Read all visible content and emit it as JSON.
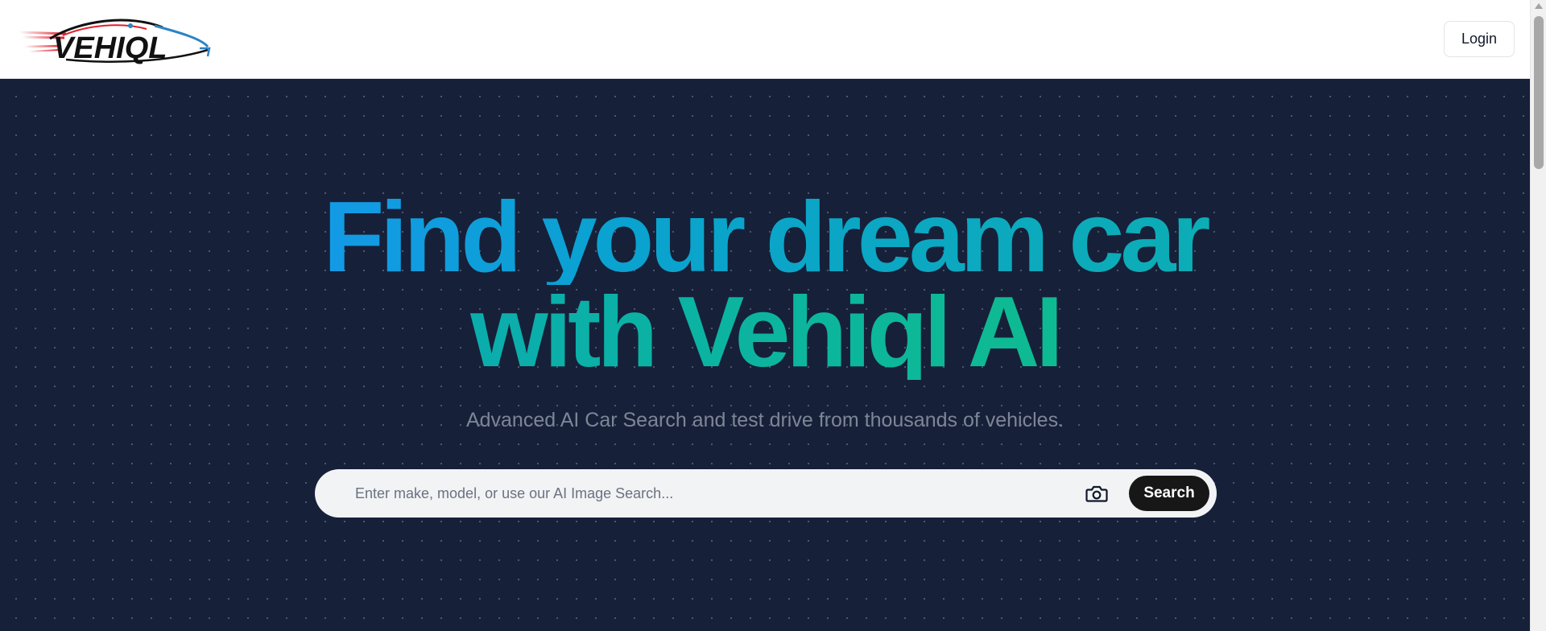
{
  "header": {
    "logo_text": "VEHIQL",
    "login_label": "Login"
  },
  "hero": {
    "headline_line1": "Find your dream car",
    "headline_line2": "with Vehiql AI",
    "subtitle": "Advanced AI Car Search and test drive from thousands of vehicles.",
    "search": {
      "placeholder": "Enter make, model, or use our AI Image Search...",
      "value": "",
      "camera_icon": "camera-icon",
      "button_label": "Search"
    }
  },
  "colors": {
    "hero_bg": "#172039",
    "gradient_start": "#1e90ff",
    "gradient_end": "#12c47c",
    "search_button_bg": "#171717"
  }
}
